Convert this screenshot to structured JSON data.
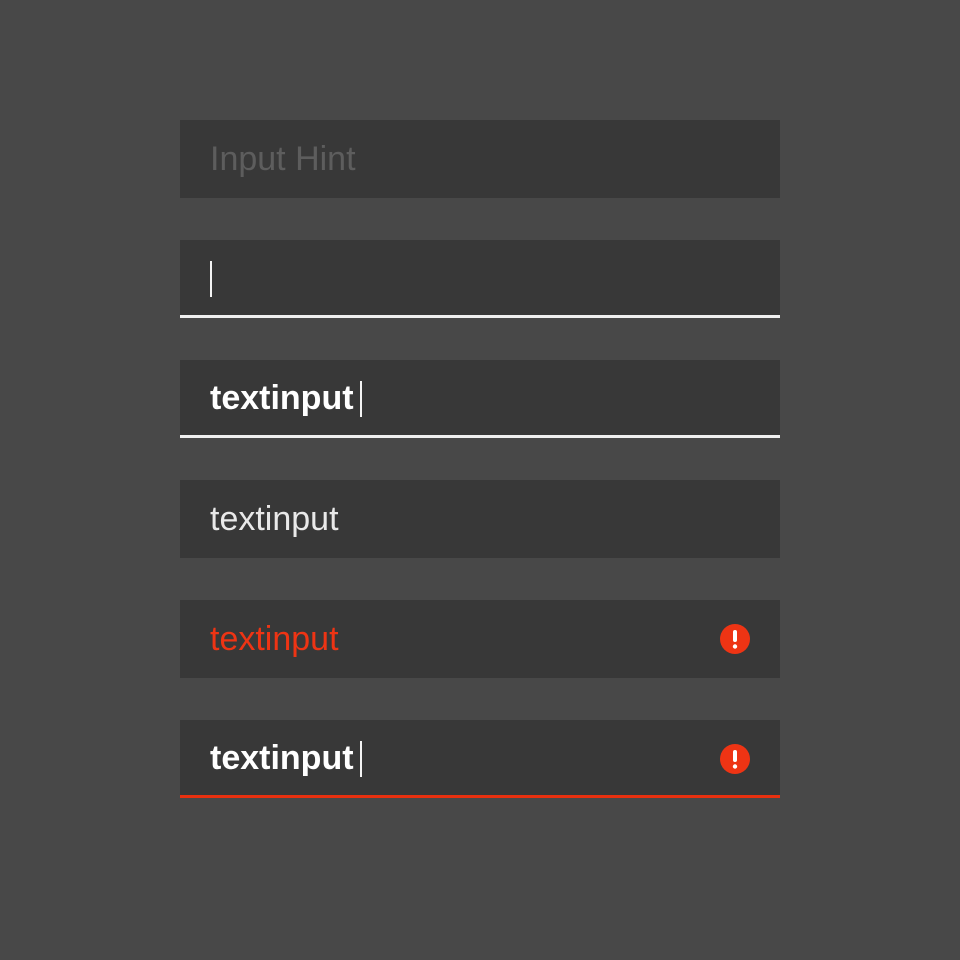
{
  "fields": [
    {
      "state": "hint",
      "placeholder": "Input Hint",
      "value": ""
    },
    {
      "state": "focused-empty",
      "value": ""
    },
    {
      "state": "focused-filled",
      "value": "textinput"
    },
    {
      "state": "filled",
      "value": "textinput"
    },
    {
      "state": "error",
      "value": "textinput",
      "icon": "error-exclamation-icon"
    },
    {
      "state": "error-focused",
      "value": "textinput",
      "icon": "error-exclamation-icon"
    }
  ],
  "colors": {
    "background": "#484848",
    "field": "#383838",
    "hint_text": "#5d5d5d",
    "active_underline": "#f0f0f0",
    "error": "#ee3414"
  }
}
